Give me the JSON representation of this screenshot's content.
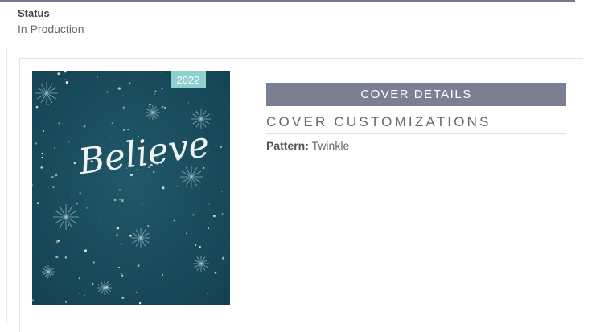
{
  "status": {
    "label": "Status",
    "value": "In Production"
  },
  "cover": {
    "year_badge": "2022",
    "script_title": "Believe",
    "colors": {
      "background": "#1a4d5c",
      "badge": "#8fd0cf",
      "stars": "#f3e9c9"
    }
  },
  "details": {
    "header": "COVER DETAILS",
    "customizations_title": "COVER CUSTOMIZATIONS",
    "pattern_label": "Pattern:",
    "pattern_value": "Twinkle"
  },
  "colors": {
    "header_bar": "#7b7f93",
    "rule": "#e3e3e3"
  }
}
